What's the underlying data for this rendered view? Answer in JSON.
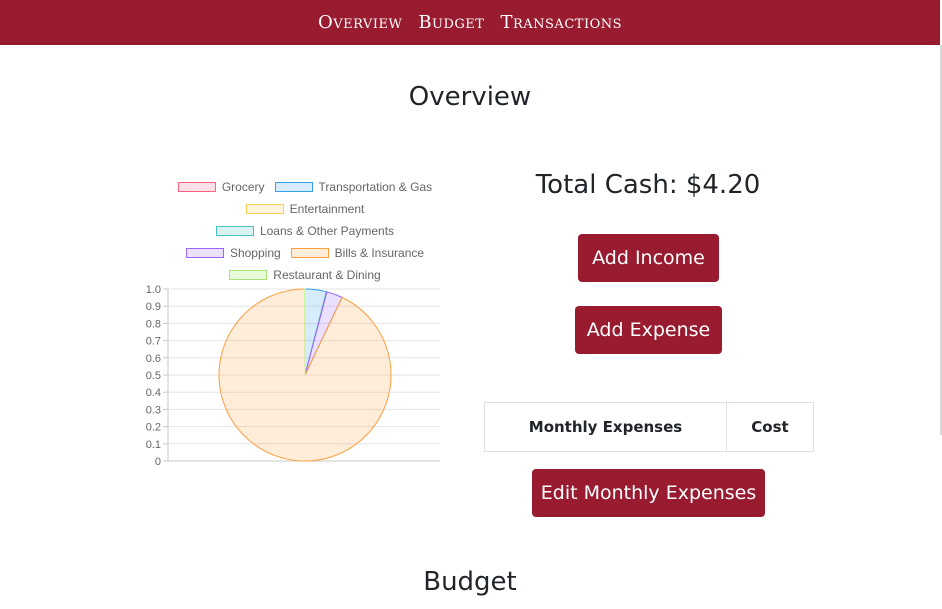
{
  "nav": {
    "items": [
      "Overview",
      "Budget",
      "Transactions"
    ]
  },
  "overview": {
    "title": "Overview",
    "total_cash_label": "Total Cash: $4.20",
    "add_income_label": "Add Income",
    "add_expense_label": "Add Expense",
    "table_headers": [
      "Monthly Expenses",
      "Cost"
    ],
    "edit_monthly_label": "Edit Monthly Expenses"
  },
  "budget": {
    "title": "Budget"
  },
  "colors": {
    "brand": "#981b2f"
  },
  "chart_data": {
    "type": "pie",
    "categories": [
      "Grocery",
      "Transportation & Gas",
      "Entertainment",
      "Loans & Other Payments",
      "Shopping",
      "Bills & Insurance",
      "Restaurant & Dining"
    ],
    "values": [
      0,
      0.04,
      0,
      0.001,
      0.03,
      0.93,
      0.001
    ],
    "colors": [
      "#ff6384",
      "#36a2eb",
      "#ffcd56",
      "#4bc0c0",
      "#9966ff",
      "#ff9f40",
      "#c9f7a0"
    ],
    "y_ticks": [
      "1.0",
      "0.9",
      "0.8",
      "0.7",
      "0.6",
      "0.5",
      "0.4",
      "0.3",
      "0.2",
      "0.1",
      "0"
    ],
    "legend_position": "top",
    "grid": true
  }
}
